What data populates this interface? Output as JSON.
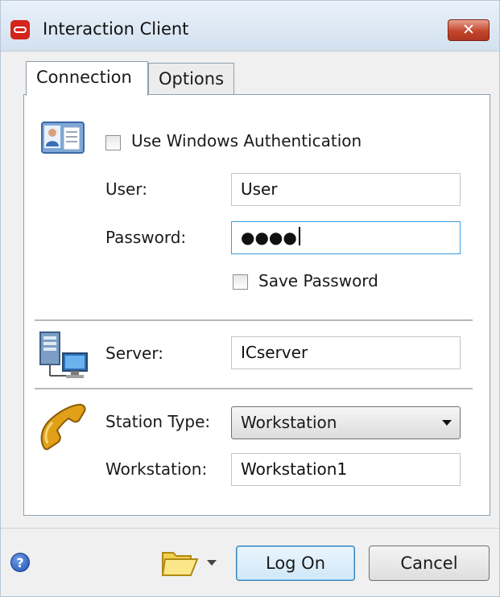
{
  "window": {
    "title": "Interaction Client",
    "close_symbol": "✕"
  },
  "tabs": [
    {
      "label": "Connection",
      "active": true
    },
    {
      "label": "Options",
      "active": false
    }
  ],
  "auth": {
    "use_windows_auth_label": "Use Windows Authentication",
    "use_windows_auth_checked": false,
    "user_label": "User:",
    "user_value": "User",
    "password_label": "Password:",
    "password_masked": "●●●●",
    "save_password_label": "Save Password",
    "save_password_checked": false
  },
  "server": {
    "label": "Server:",
    "value": "ICserver"
  },
  "station": {
    "type_label": "Station Type:",
    "type_value": "Workstation",
    "workstation_label": "Workstation:",
    "workstation_value": "Workstation1"
  },
  "footer": {
    "help_symbol": "?",
    "logon_label": "Log On",
    "cancel_label": "Cancel"
  },
  "icons": [
    "app-logo-icon",
    "id-card-icon",
    "server-computer-icon",
    "telephone-icon",
    "help-icon",
    "folder-icon",
    "dropdown-arrow-icon"
  ]
}
